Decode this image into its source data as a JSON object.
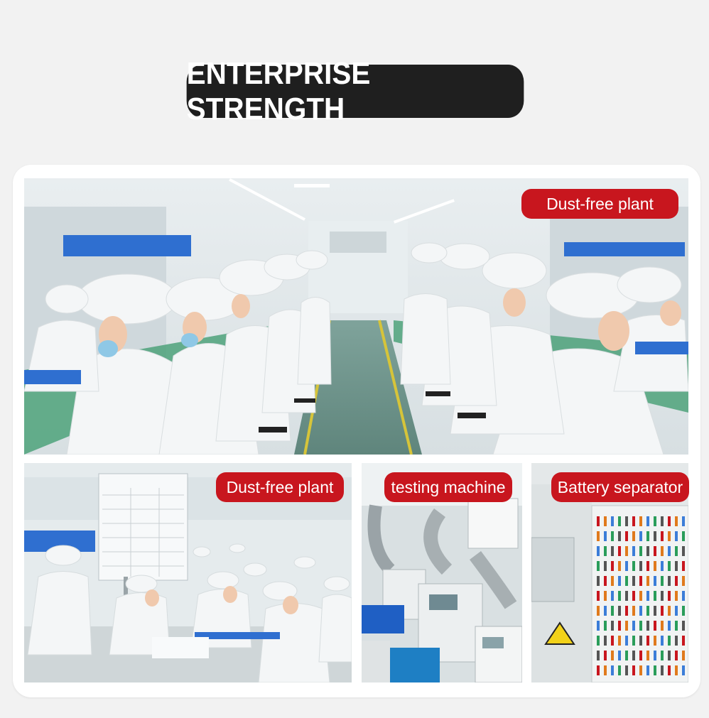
{
  "heading": {
    "title": "ENTERPRISE STRENGTH"
  },
  "photos": {
    "main": {
      "label": "Dust-free plant"
    },
    "bottom_left": {
      "label": "Dust-free plant"
    },
    "bottom_middle": {
      "label": "testing machine"
    },
    "bottom_right": {
      "label": "Battery separator"
    }
  },
  "colors": {
    "title_bg": "#1f1f1f",
    "tag_bg": "#c8161e",
    "card_bg": "#ffffff",
    "page_bg": "#f2f2f2"
  }
}
